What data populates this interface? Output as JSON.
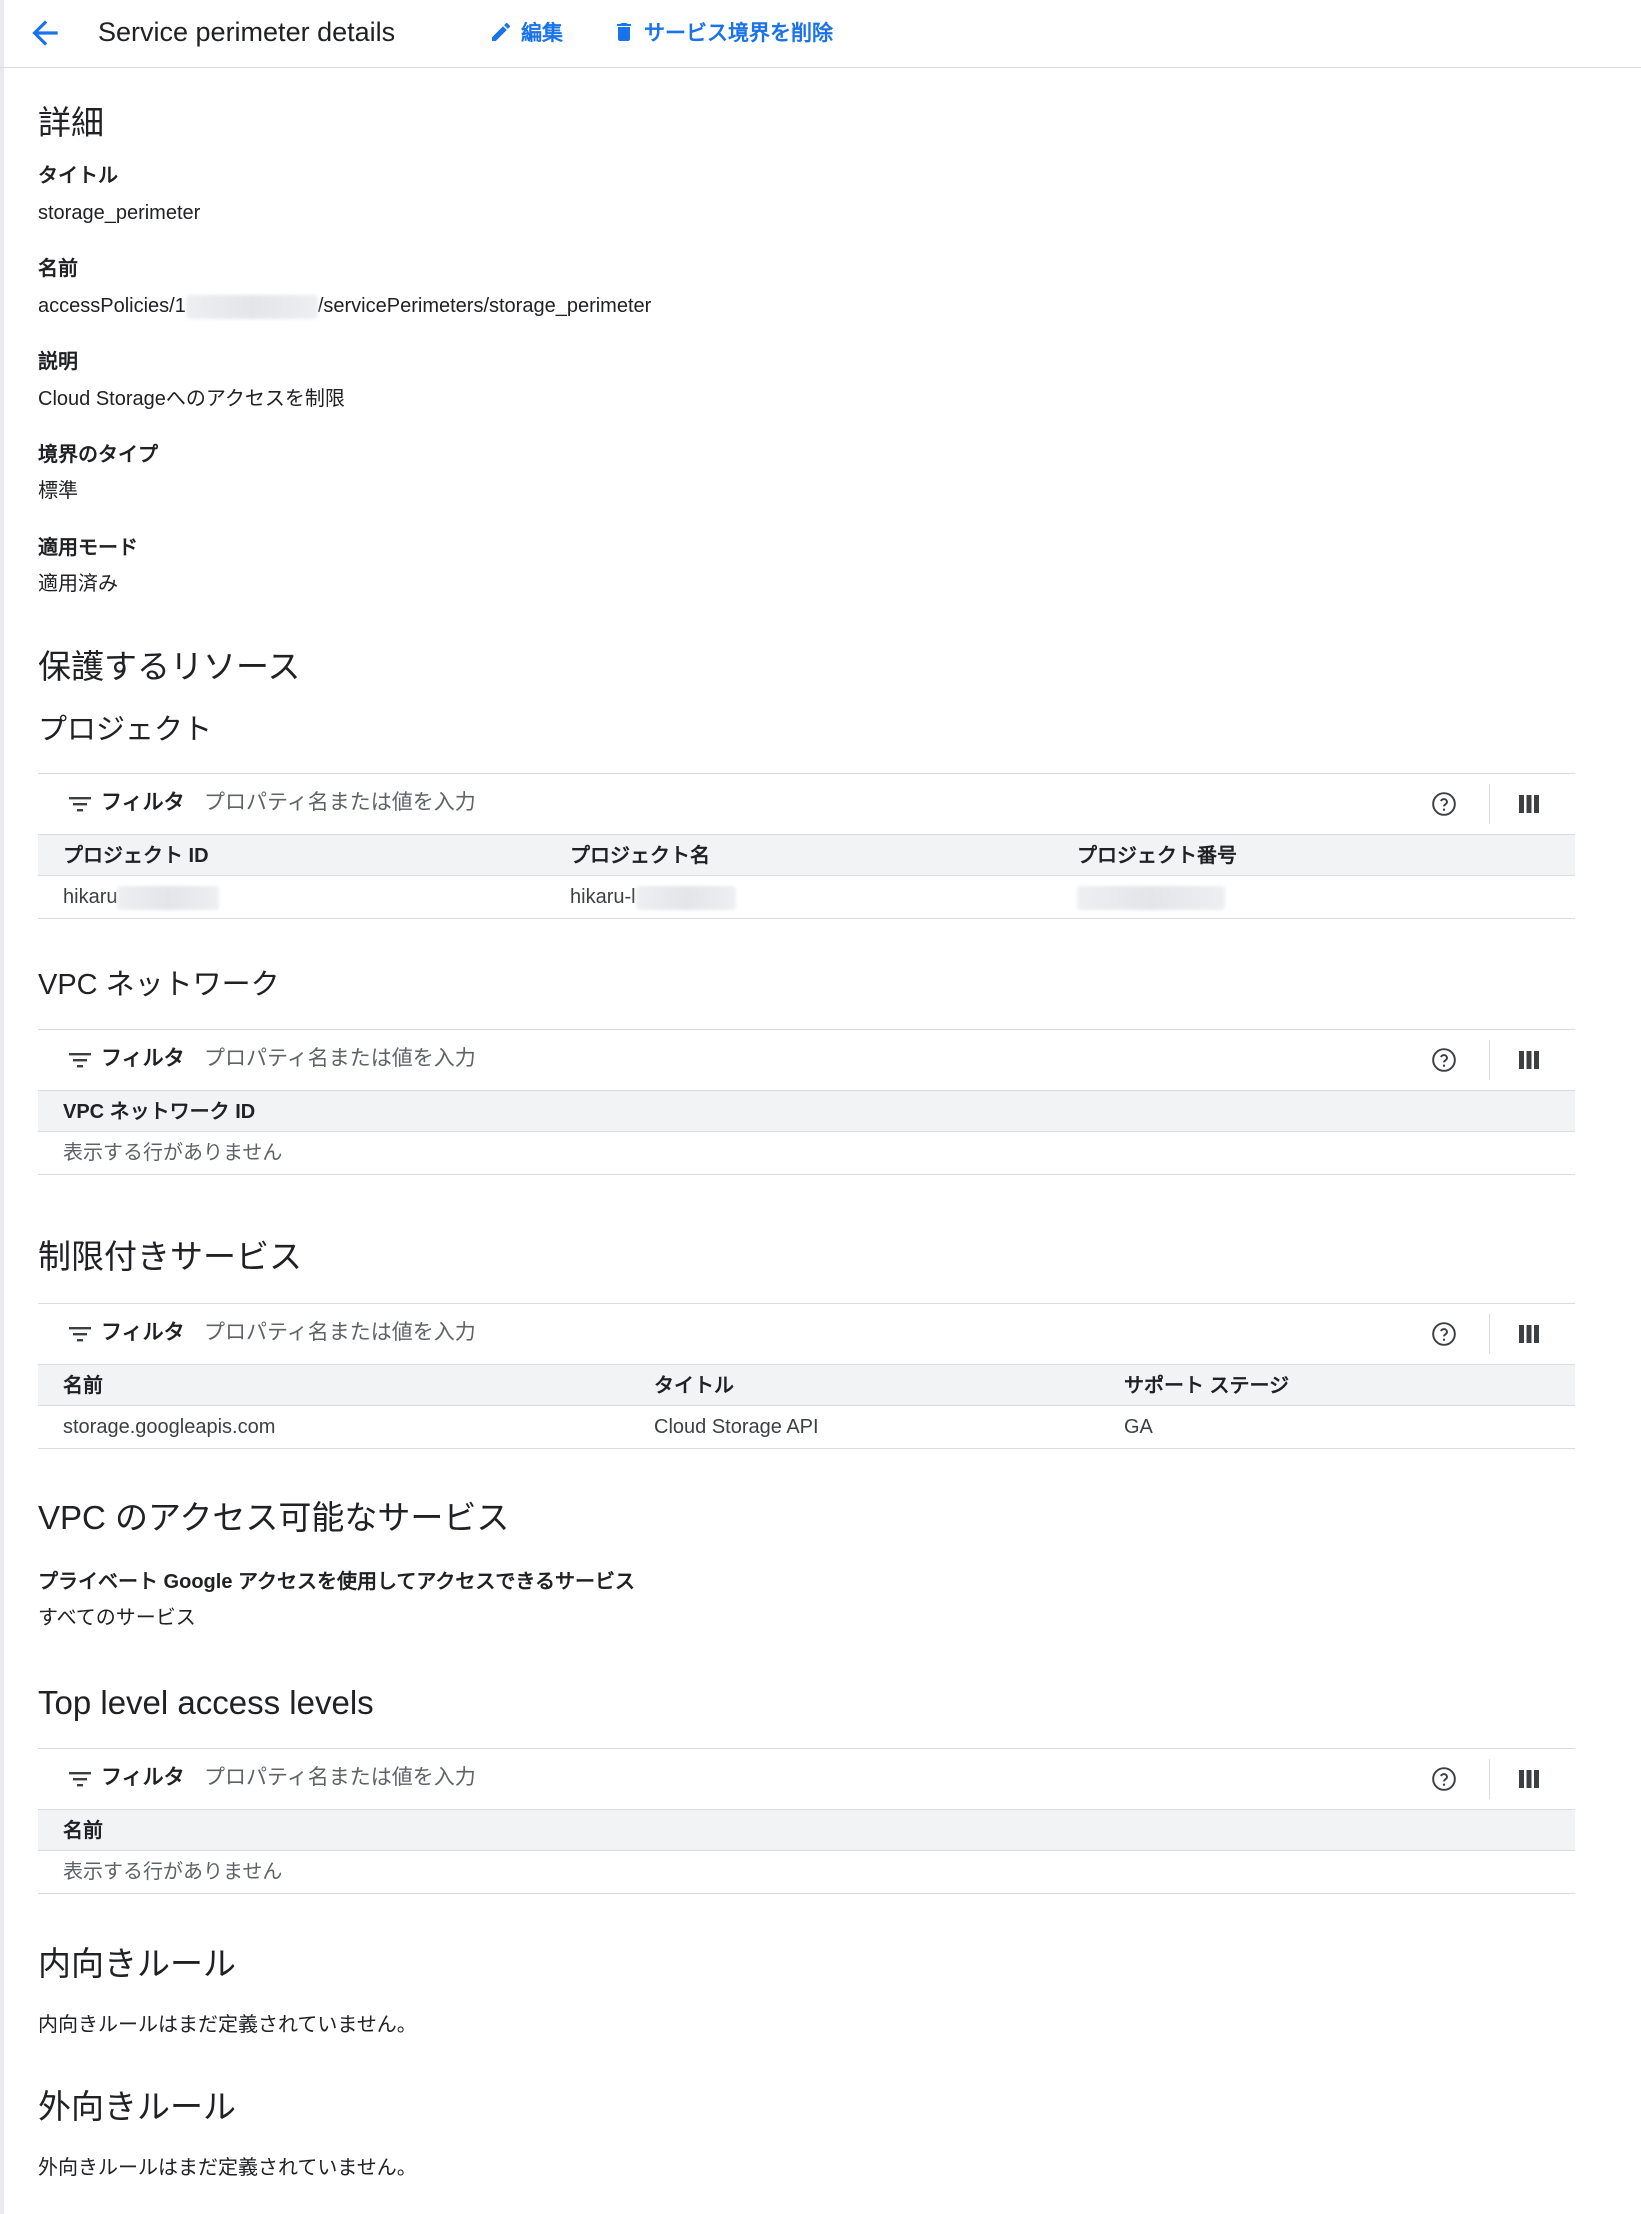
{
  "header": {
    "title": "Service perimeter details",
    "edit_label": "編集",
    "delete_label": "サービス境界を削除"
  },
  "details": {
    "heading": "詳細",
    "fields": [
      {
        "label": "タイトル",
        "value": "storage_perimeter"
      },
      {
        "label": "名前",
        "value_prefix": "accessPolicies/1",
        "value_suffix": "/servicePerimeters/storage_perimeter"
      },
      {
        "label": "説明",
        "value": "Cloud Storageへのアクセスを制限"
      },
      {
        "label": "境界のタイプ",
        "value": "標準"
      },
      {
        "label": "適用モード",
        "value": "適用済み"
      }
    ]
  },
  "protected": {
    "heading": "保護するリソース",
    "projects": {
      "heading": "プロジェクト",
      "filter_label": "フィルタ",
      "placeholder": "プロパティ名または値を入力",
      "columns": [
        "プロジェクト ID",
        "プロジェクト名",
        "プロジェクト番号"
      ],
      "rows": [
        {
          "id": "hikaru",
          "name": "hikaru-l",
          "number": ""
        }
      ]
    },
    "vpc": {
      "heading": "VPC ネットワーク",
      "filter_label": "フィルタ",
      "placeholder": "プロパティ名または値を入力",
      "columns": [
        "VPC ネットワーク ID"
      ],
      "empty": "表示する行がありません"
    }
  },
  "restricted": {
    "heading": "制限付きサービス",
    "filter_label": "フィルタ",
    "placeholder": "プロパティ名または値を入力",
    "columns": [
      "名前",
      "タイトル",
      "サポート ステージ"
    ],
    "rows": [
      {
        "name": "storage.googleapis.com",
        "title": "Cloud Storage API",
        "stage": "GA"
      }
    ]
  },
  "vpc_accessible": {
    "heading": "VPC のアクセス可能なサービス",
    "label": "プライベート Google アクセスを使用してアクセスできるサービス",
    "value": "すべてのサービス"
  },
  "access_levels": {
    "heading": "Top level access levels",
    "filter_label": "フィルタ",
    "placeholder": "プロパティ名または値を入力",
    "columns": [
      "名前"
    ],
    "empty": "表示する行がありません"
  },
  "ingress": {
    "heading": "内向きルール",
    "text": "内向きルールはまだ定義されていません。"
  },
  "egress": {
    "heading": "外向きルール",
    "text": "外向きルールはまだ定義されていません。"
  },
  "icons": {
    "back": "arrow-back-icon",
    "edit": "pencil-icon",
    "delete": "trash-icon",
    "filter": "filter-icon",
    "help": "help-circle-icon",
    "columns": "column-display-icon"
  },
  "colors": {
    "accent": "#1a73e8",
    "header_bg": "#f1f3f4",
    "border": "#dadce0"
  }
}
